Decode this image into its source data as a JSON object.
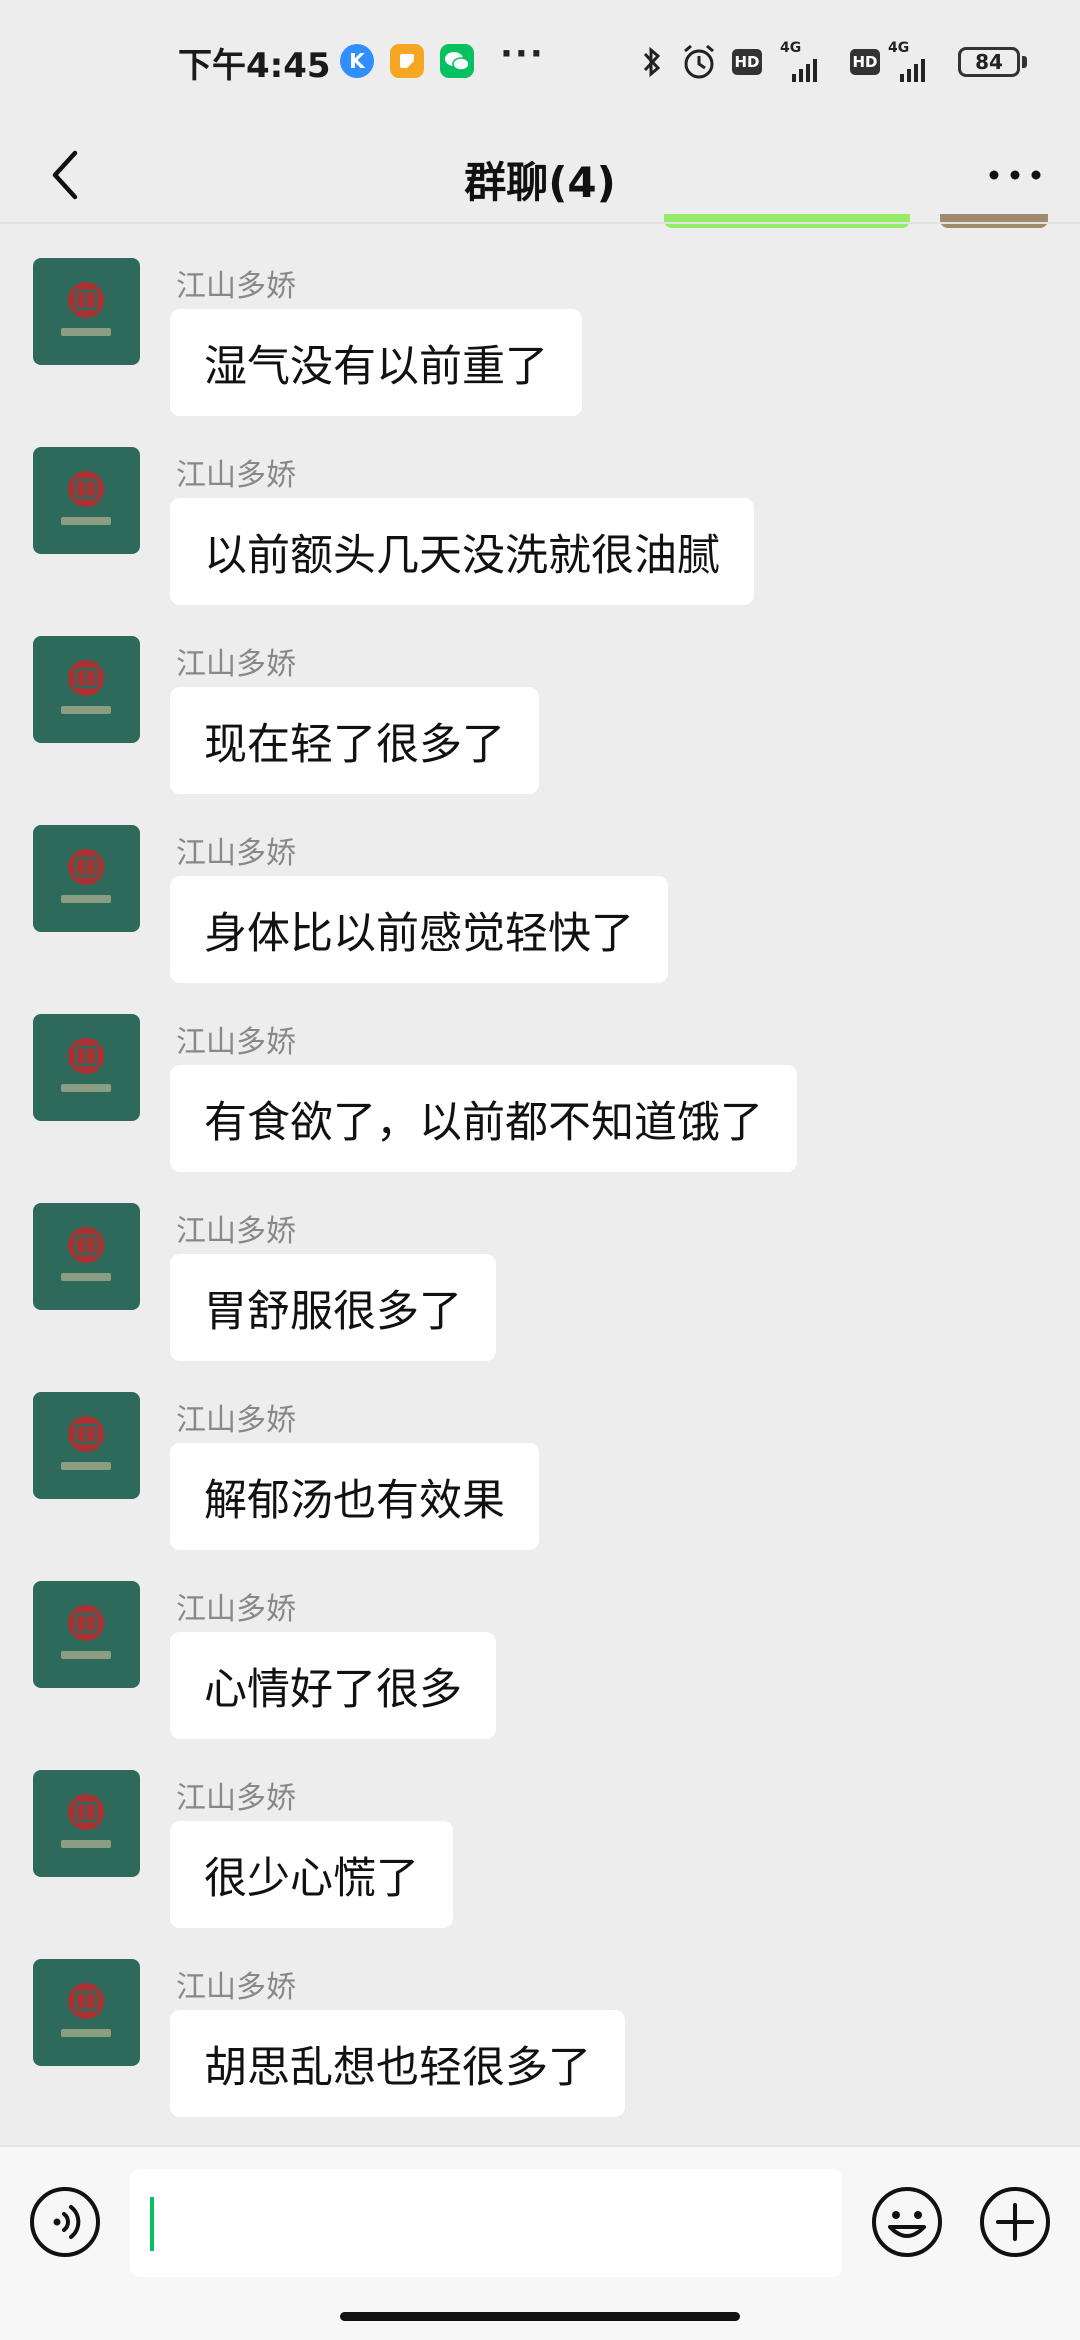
{
  "status_bar": {
    "time": "下午4:45",
    "app_icons": [
      {
        "name": "k-app-icon",
        "glyph": "K",
        "color": "#2f8fff"
      },
      {
        "name": "notes-app-icon",
        "glyph": "▪",
        "color": "#f6a623"
      },
      {
        "name": "wechat-app-icon",
        "glyph": "●",
        "color": "#07c160"
      }
    ],
    "more": "···",
    "hd1": "HD",
    "net1": "4G",
    "hd2": "HD",
    "net2": "4G",
    "battery": "84"
  },
  "nav": {
    "title": "群聊(4)"
  },
  "sender_name": "江山多娇",
  "messages": [
    {
      "sender": "江山多娇",
      "text": "湿气没有以前重了"
    },
    {
      "sender": "江山多娇",
      "text": "以前额头几天没洗就很油腻"
    },
    {
      "sender": "江山多娇",
      "text": "现在轻了很多了"
    },
    {
      "sender": "江山多娇",
      "text": "身体比以前感觉轻快了"
    },
    {
      "sender": "江山多娇",
      "text": "有食欲了，以前都不知道饿了"
    },
    {
      "sender": "江山多娇",
      "text": "胃舒服很多了"
    },
    {
      "sender": "江山多娇",
      "text": "解郁汤也有效果"
    },
    {
      "sender": "江山多娇",
      "text": "心情好了很多"
    },
    {
      "sender": "江山多娇",
      "text": "很少心慌了"
    },
    {
      "sender": "江山多娇",
      "text": "胡思乱想也轻很多了"
    }
  ],
  "input": {
    "value": ""
  },
  "colors": {
    "background": "#ededed",
    "bubble": "#ffffff",
    "self_bubble": "#95ec69",
    "avatar": "#2e6a5b",
    "caret": "#07c160"
  }
}
